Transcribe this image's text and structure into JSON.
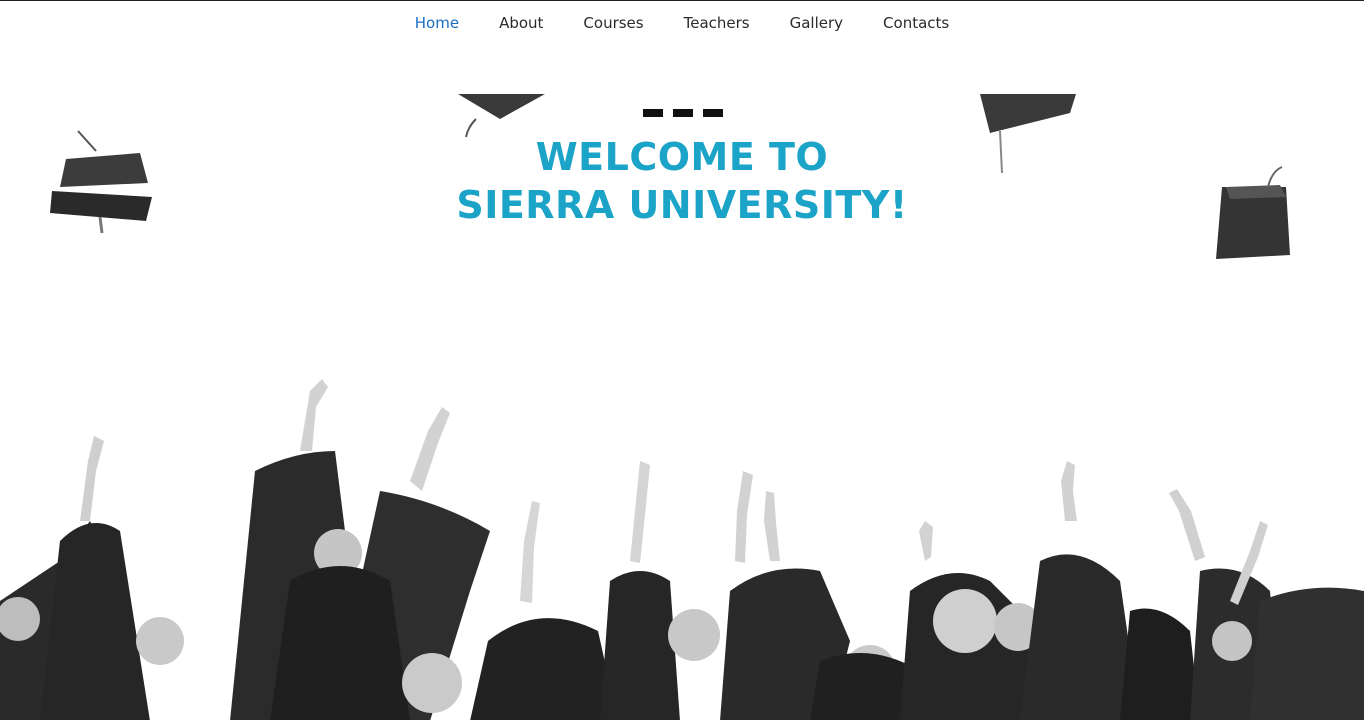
{
  "nav": {
    "items": [
      {
        "label": "Home",
        "active": true
      },
      {
        "label": "About",
        "active": false
      },
      {
        "label": "Courses",
        "active": false
      },
      {
        "label": "Teachers",
        "active": false
      },
      {
        "label": "Gallery",
        "active": false
      },
      {
        "label": "Contacts",
        "active": false
      }
    ]
  },
  "hero": {
    "title_line1": "WELCOME TO",
    "title_line2": "SIERRA UNIVERSITY!"
  },
  "colors": {
    "accent": "#1ba3c8",
    "nav_active": "#1a6fc4",
    "nav_text": "#2b2b2b",
    "background": "#ffffff"
  },
  "image": {
    "subject": "graduates-throwing-caps-photo"
  }
}
